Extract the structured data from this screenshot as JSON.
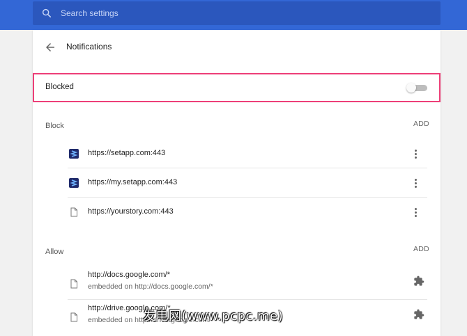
{
  "search": {
    "placeholder": "Search settings",
    "value": ""
  },
  "header": {
    "title": "Notifications",
    "back_icon": "arrow-back-icon"
  },
  "blocked_setting": {
    "label": "Blocked",
    "enabled": false
  },
  "block_section": {
    "title": "Block",
    "add_label": "ADD",
    "sites": [
      {
        "url": "https://setapp.com:443",
        "icon": "setapp-favicon"
      },
      {
        "url": "https://my.setapp.com:443",
        "icon": "setapp-favicon"
      },
      {
        "url": "https://yourstory.com:443",
        "icon": "page-icon"
      }
    ]
  },
  "allow_section": {
    "title": "Allow",
    "add_label": "ADD",
    "sites": [
      {
        "url": "http://docs.google.com/*",
        "sub": "embedded on http://docs.google.com/*",
        "icon": "page-icon",
        "action_icon": "extension-icon"
      },
      {
        "url": "http://drive.google.com/*",
        "sub": "embedded on http://drive.google.com/*",
        "icon": "page-icon",
        "action_icon": "extension-icon"
      }
    ]
  },
  "colors": {
    "header_blue": "#3367d6",
    "highlight_pink": "#ed3f78"
  },
  "watermark": "发电网(www.pcpc.me)"
}
